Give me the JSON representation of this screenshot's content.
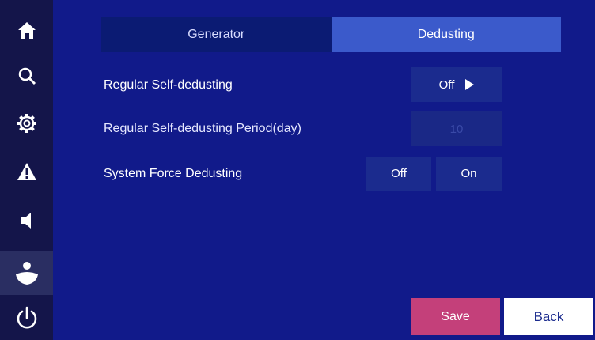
{
  "sidebar": {
    "items": [
      {
        "icon": "home-icon"
      },
      {
        "icon": "search-icon"
      },
      {
        "icon": "gear-icon"
      },
      {
        "icon": "warning-icon"
      },
      {
        "icon": "speaker-icon"
      },
      {
        "icon": "user-icon",
        "active": true
      },
      {
        "icon": "power-icon"
      }
    ]
  },
  "tabs": [
    {
      "label": "Generator",
      "active": false
    },
    {
      "label": "Dedusting",
      "active": true
    }
  ],
  "settings": {
    "regular_self_dedusting": {
      "label": "Regular Self-dedusting",
      "value": "Off"
    },
    "period": {
      "label": "Regular Self-dedusting Period(day)",
      "value": "10"
    },
    "force": {
      "label": "System Force Dedusting",
      "off_label": "Off",
      "on_label": "On"
    }
  },
  "footer": {
    "save_label": "Save",
    "back_label": "Back"
  },
  "colors": {
    "background": "#111a8a",
    "sidebar": "#14154a",
    "accent_save": "#c4407a",
    "tab_active": "#3b5acb"
  }
}
